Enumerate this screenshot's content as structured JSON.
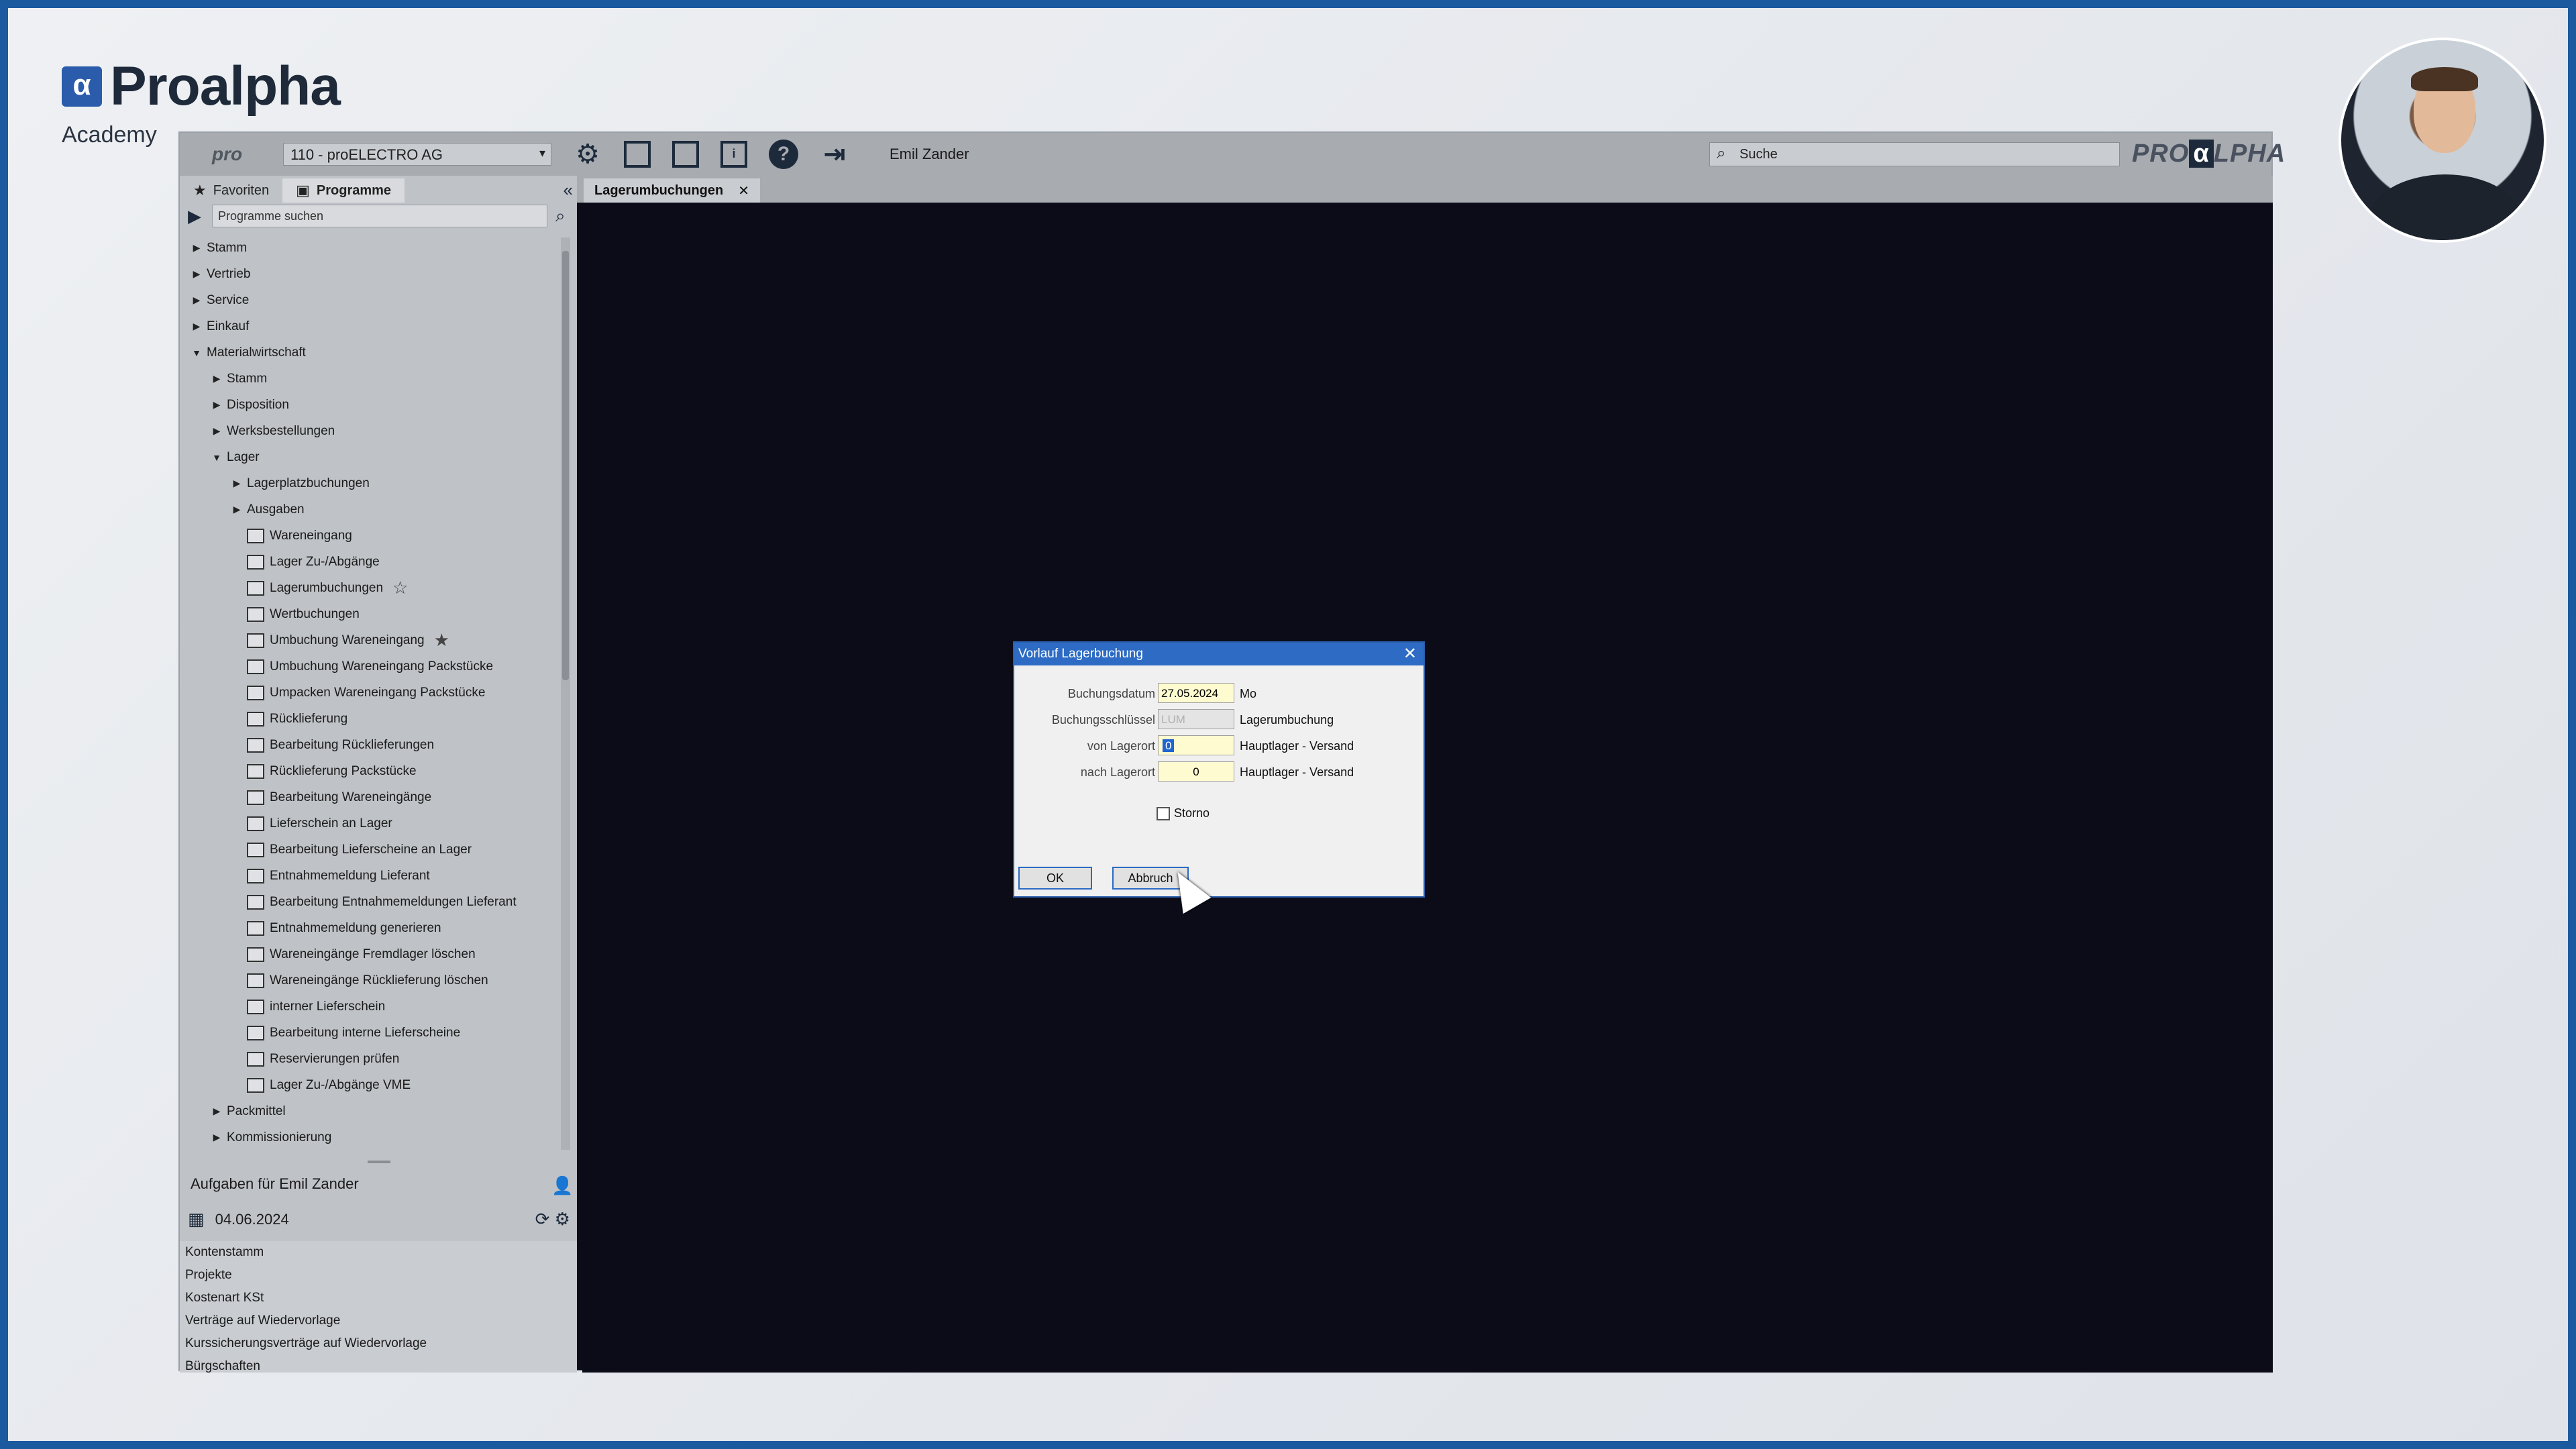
{
  "logo": {
    "name": "Proalpha",
    "sub": "Academy",
    "mark": "α"
  },
  "toolbar": {
    "pro_logo": "pro",
    "company": "110 - proELECTRO AG",
    "info_icon_glyph": "i",
    "help_icon_glyph": "?",
    "user": "Emil Zander",
    "search_placeholder": "Suche",
    "brand_left": "PRO",
    "brand_alpha": "α",
    "brand_right": "LPHA"
  },
  "left_panel": {
    "tabs": [
      {
        "label": "Favoriten",
        "icon": "star-icon"
      },
      {
        "label": "Programme",
        "icon": "programs-icon",
        "active": true
      }
    ],
    "program_search_placeholder": "Programme suchen",
    "tree": [
      {
        "label": "Stamm",
        "level": 0,
        "type": "folder",
        "expanded": false
      },
      {
        "label": "Vertrieb",
        "level": 0,
        "type": "folder",
        "expanded": false
      },
      {
        "label": "Service",
        "level": 0,
        "type": "folder",
        "expanded": false
      },
      {
        "label": "Einkauf",
        "level": 0,
        "type": "folder",
        "expanded": false
      },
      {
        "label": "Materialwirtschaft",
        "level": 0,
        "type": "folder",
        "expanded": true
      },
      {
        "label": "Stamm",
        "level": 1,
        "type": "folder",
        "expanded": false
      },
      {
        "label": "Disposition",
        "level": 1,
        "type": "folder",
        "expanded": false
      },
      {
        "label": "Werksbestellungen",
        "level": 1,
        "type": "folder",
        "expanded": false
      },
      {
        "label": "Lager",
        "level": 1,
        "type": "folder",
        "expanded": true
      },
      {
        "label": "Lagerplatzbuchungen",
        "level": 2,
        "type": "folder",
        "expanded": false
      },
      {
        "label": "Ausgaben",
        "level": 2,
        "type": "folder",
        "expanded": false
      },
      {
        "label": "Wareneingang",
        "level": 2,
        "type": "program"
      },
      {
        "label": "Lager Zu-/Abgänge",
        "level": 2,
        "type": "program"
      },
      {
        "label": "Lagerumbuchungen",
        "level": 2,
        "type": "program",
        "star": "☆"
      },
      {
        "label": "Wertbuchungen",
        "level": 2,
        "type": "program"
      },
      {
        "label": "Umbuchung Wareneingang",
        "level": 2,
        "type": "program",
        "star": "★"
      },
      {
        "label": "Umbuchung Wareneingang Packstücke",
        "level": 2,
        "type": "program"
      },
      {
        "label": "Umpacken Wareneingang Packstücke",
        "level": 2,
        "type": "program"
      },
      {
        "label": "Rücklieferung",
        "level": 2,
        "type": "program"
      },
      {
        "label": "Bearbeitung Rücklieferungen",
        "level": 2,
        "type": "program"
      },
      {
        "label": "Rücklieferung Packstücke",
        "level": 2,
        "type": "program"
      },
      {
        "label": "Bearbeitung Wareneingänge",
        "level": 2,
        "type": "program"
      },
      {
        "label": "Lieferschein an Lager",
        "level": 2,
        "type": "program"
      },
      {
        "label": "Bearbeitung Lieferscheine an Lager",
        "level": 2,
        "type": "program"
      },
      {
        "label": "Entnahmemeldung Lieferant",
        "level": 2,
        "type": "program"
      },
      {
        "label": "Bearbeitung Entnahmemeldungen Lieferant",
        "level": 2,
        "type": "program"
      },
      {
        "label": "Entnahmemeldung generieren",
        "level": 2,
        "type": "program"
      },
      {
        "label": "Wareneingänge Fremdlager löschen",
        "level": 2,
        "type": "program"
      },
      {
        "label": "Wareneingänge Rücklieferung löschen",
        "level": 2,
        "type": "program"
      },
      {
        "label": "interner Lieferschein",
        "level": 2,
        "type": "program"
      },
      {
        "label": "Bearbeitung interne Lieferscheine",
        "level": 2,
        "type": "program"
      },
      {
        "label": "Reservierungen prüfen",
        "level": 2,
        "type": "program"
      },
      {
        "label": "Lager Zu-/Abgänge VME",
        "level": 2,
        "type": "program"
      },
      {
        "label": "Packmittel",
        "level": 1,
        "type": "folder",
        "expanded": false
      },
      {
        "label": "Kommissionierung",
        "level": 1,
        "type": "folder",
        "expanded": false
      }
    ]
  },
  "tasks": {
    "title": "Aufgaben für Emil Zander",
    "date": "04.06.2024",
    "items": [
      "Kontenstamm",
      "Projekte",
      "Kostenart KSt",
      "Verträge auf Wiedervorlage",
      "Kurssicherungsverträge auf Wiedervorlage",
      "Bürgschaften"
    ]
  },
  "main": {
    "tab_label": "Lagerumbuchungen",
    "tab_close": "✕"
  },
  "dialog": {
    "title": "Vorlauf Lagerbuchung",
    "close": "✕",
    "rows": [
      {
        "label": "Buchungsdatum",
        "value": "27.05.2024",
        "desc": "Mo"
      },
      {
        "label": "Buchungsschlüssel",
        "value": "LUM",
        "desc": "Lagerumbuchung"
      },
      {
        "label": "von Lagerort",
        "value": "0",
        "desc": "Hauptlager - Versand"
      },
      {
        "label": "nach Lagerort",
        "value": "0",
        "desc": "Hauptlager - Versand"
      }
    ],
    "storno_label": "Storno",
    "ok_label": "OK",
    "cancel_label": "Abbruch"
  },
  "colors": {
    "accent": "#2d6bc4",
    "app_background": "#0b0c18",
    "panel": "#bfc2c6",
    "toolbar": "#a8abb0",
    "frame_border": "#1c5aa0"
  }
}
